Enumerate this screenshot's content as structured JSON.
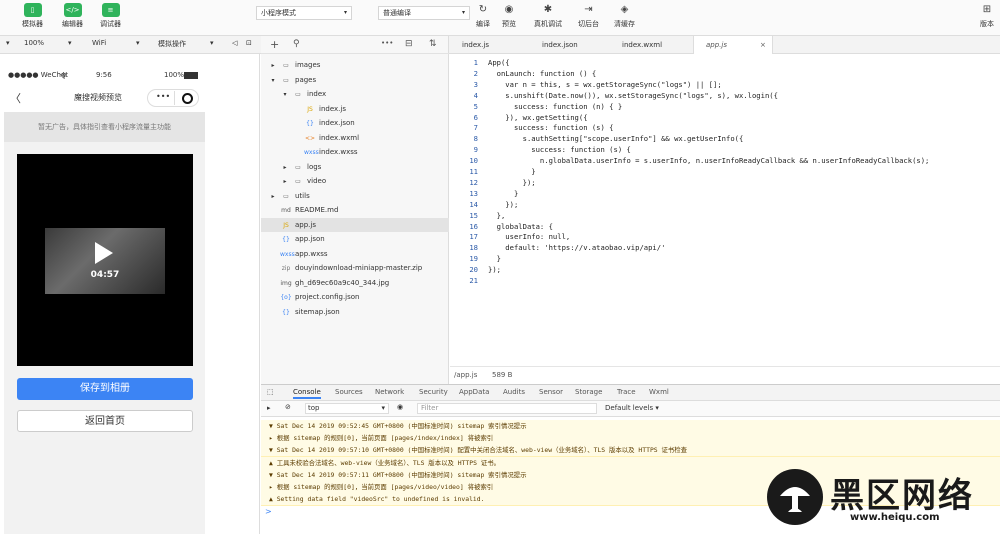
{
  "toolbar": {
    "simulator": "模拟器",
    "editor": "编辑器",
    "debugger": "调试器",
    "mode_select": "小程序模式",
    "compile_select": "普通编译",
    "compile": "编译",
    "preview": "预览",
    "remote_debug": "真机调试",
    "backend": "切后台",
    "clear_cache": "清缓存",
    "right_label": "版本"
  },
  "subbar": {
    "device": "",
    "zoom": "100%",
    "network": "WiFi",
    "operation": "模拟操作"
  },
  "phone": {
    "carrier": "●●●●● WeChat",
    "wifi": "令",
    "time": "9:56",
    "battery": "100%",
    "back": "〈",
    "title": "魔搜视频预览",
    "more": "•••",
    "ad_text": "暂无广告，具体指引查看小程序流量主功能",
    "video_time": "04:57",
    "save_button": "保存到相册",
    "back_button": "返回首页"
  },
  "filetree": {
    "toolbar_add": "+",
    "toolbar_search": "⚲",
    "toolbar_more": "•••",
    "items": [
      {
        "label": "images",
        "icon": "folder",
        "arrow": "▸"
      },
      {
        "label": "pages",
        "icon": "folder-open",
        "arrow": "▾"
      },
      {
        "label": "index",
        "icon": "folder-open",
        "arrow": "▾"
      },
      {
        "label": "index.js",
        "icon": "JS"
      },
      {
        "label": "index.json",
        "icon": "{}"
      },
      {
        "label": "index.wxml",
        "icon": "<>"
      },
      {
        "label": "index.wxss",
        "icon": "wxss"
      },
      {
        "label": "logs",
        "icon": "folder",
        "arrow": "▸"
      },
      {
        "label": "video",
        "icon": "folder",
        "arrow": "▸"
      },
      {
        "label": "utils",
        "icon": "folder",
        "arrow": "▸"
      },
      {
        "label": "README.md",
        "icon": "md"
      },
      {
        "label": "app.js",
        "icon": "JS"
      },
      {
        "label": "app.json",
        "icon": "{}"
      },
      {
        "label": "app.wxss",
        "icon": "wxss"
      },
      {
        "label": "douyindownload-miniapp-master.zip",
        "icon": "zip"
      },
      {
        "label": "gh_d69ec60a9c40_344.jpg",
        "icon": "img"
      },
      {
        "label": "project.config.json",
        "icon": "{o}"
      },
      {
        "label": "sitemap.json",
        "icon": "{}"
      }
    ]
  },
  "editor": {
    "tabs": [
      "index.js",
      "index.json",
      "index.wxml",
      "app.js"
    ],
    "close": "×",
    "lines": [
      "App({",
      "  onLaunch: function () {",
      "    var n = this, s = wx.getStorageSync(\"logs\") || [];",
      "    s.unshift(Date.now()), wx.setStorageSync(\"logs\", s), wx.login({",
      "      success: function (n) { }",
      "    }), wx.getSetting({",
      "      success: function (s) {",
      "        s.authSetting[\"scope.userInfo\"] && wx.getUserInfo({",
      "          success: function (s) {",
      "            n.globalData.userInfo = s.userInfo, n.userInfoReadyCallback && n.userInfoReadyCallback(s);",
      "          }",
      "        });",
      "      }",
      "    });",
      "  },",
      "  globalData: {",
      "    userInfo: null,",
      "    default: 'https://v.ataobao.vip/api/'",
      "  }",
      "});",
      ""
    ],
    "file_path": "/app.js",
    "file_size": "589 B"
  },
  "console": {
    "tabs": [
      "Console",
      "Sources",
      "Network",
      "Security",
      "AppData",
      "Audits",
      "Sensor",
      "Storage",
      "Trace",
      "Wxml"
    ],
    "context": "top",
    "filter_placeholder": "Filter",
    "levels": "Default levels ▾",
    "messages": [
      {
        "type": "warn",
        "text": "▼ Sat Dec 14 2019 09:52:45 GMT+0800 (中国标准时间) sitemap 索引情况提示"
      },
      {
        "type": "warn",
        "text": "  ▸ 根据 sitemap 的规则[0]，当前页面 [pages/index/index] 将被索引"
      },
      {
        "type": "warn",
        "text": "▼ Sat Dec 14 2019 09:57:10 GMT+0800 (中国标准时间) 配置中关闭合法域名、web-view（业务域名）、TLS 版本以及 HTTPS 证书检查"
      },
      {
        "type": "warn",
        "text": "  ▲ 工具未校验合法域名、web-view（业务域名）、TLS 版本以及 HTTPS 证书。"
      },
      {
        "type": "warn",
        "text": "▼ Sat Dec 14 2019 09:57:11 GMT+0800 (中国标准时间) sitemap 索引情况提示"
      },
      {
        "type": "warn",
        "text": "  ▸ 根据 sitemap 的规则[0]，当前页面 [pages/video/video] 将被索引"
      },
      {
        "type": "warn",
        "text": "▲ Setting data field \"videoSrc\" to undefined is invalid."
      }
    ],
    "prompt": ">"
  },
  "watermark": {
    "title": "黑区网络",
    "url": "www.heiqu.com"
  }
}
